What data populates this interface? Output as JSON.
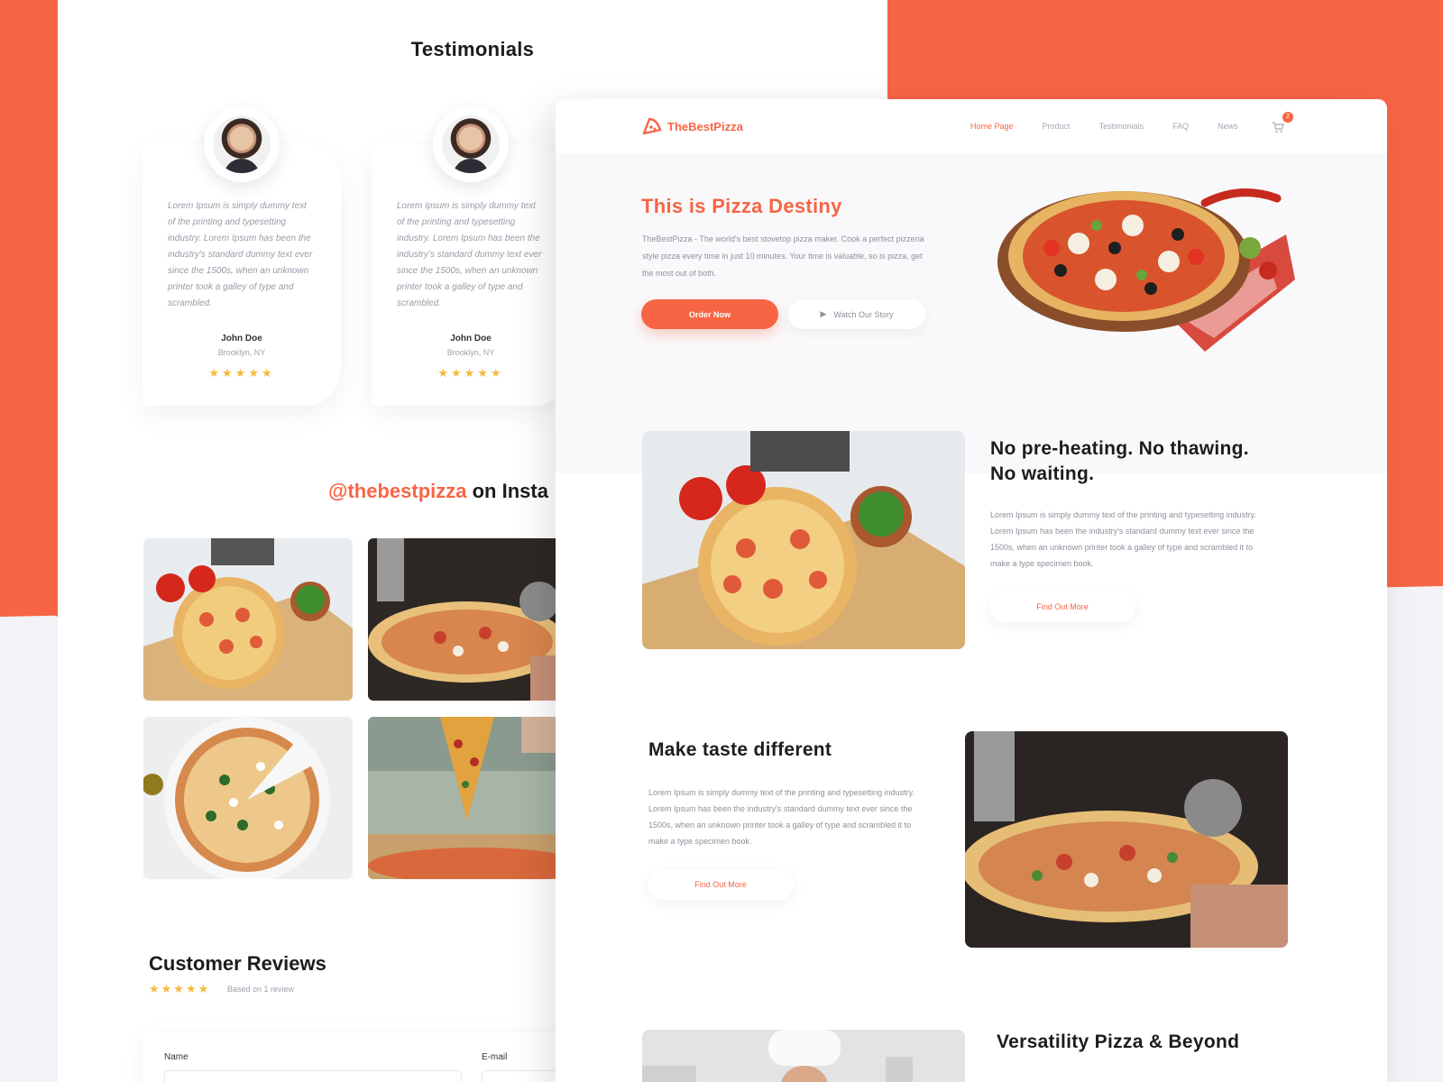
{
  "testimonials": {
    "title": "Testimonials",
    "cards": [
      {
        "text": "Lorem Ipsum is simply dummy text of the printing and typesetting industry. Lorem Ipsum has been the industry's standard dummy text ever since the 1500s, when an unknown printer took a galley of type and scrambled.",
        "name": "John Doe",
        "location": "Brooklyn, NY",
        "stars": "★★★★★"
      },
      {
        "text": "Lorem Ipsum is simply dummy text of the printing and typesetting industry. Lorem Ipsum has been the industry's standard dummy text ever since the 1500s, when an unknown printer took a galley of type and scrambled.",
        "name": "John Doe",
        "location": "Brooklyn, NY",
        "stars": "★★★★★"
      }
    ]
  },
  "instagram": {
    "handle": "@thebestpizza",
    "suffix": " on Insta"
  },
  "reviews": {
    "title": "Customer Reviews",
    "stars": "★★★★★",
    "based_on": "Based on 1 review",
    "name_label": "Name",
    "email_label": "E-mail"
  },
  "nav": {
    "logo": "TheBestPizza",
    "links": [
      "Home Page",
      "Product",
      "Testimonials",
      "FAQ",
      "News"
    ],
    "cart_count": "2"
  },
  "hero": {
    "title": "This is Pizza Destiny",
    "text": "TheBestPizza - The world's best stovetop pizza maker. Cook a perfect pizzeria style pizza every time in just 10 minutes. Your time is valuable, so is pizza, get the most out of both.",
    "order_button": "Order Now",
    "story_button": "Watch Our Story"
  },
  "features": [
    {
      "title_line1": "No pre-heating. No thawing.",
      "title_line2": "No waiting.",
      "text": "Lorem Ipsum is simply dummy text of the printing and typesetting industry. Lorem Ipsum has been the industry's standard dummy text ever since the 1500s, when an unknown printer took a galley of type and scrambled it to make a type specimen book.",
      "button": "Find Out More"
    },
    {
      "title": "Make taste different",
      "text": "Lorem Ipsum is simply dummy text of the printing and typesetting industry. Lorem Ipsum has been the industry's standard dummy text ever since the 1500s, when an unknown printer took a galley of type and scrambled it to make a type specimen book.",
      "button": "Find Out More"
    },
    {
      "title": "Versatility Pizza & Beyond"
    }
  ],
  "colors": {
    "accent": "#f76545",
    "star": "#f6b93b"
  }
}
